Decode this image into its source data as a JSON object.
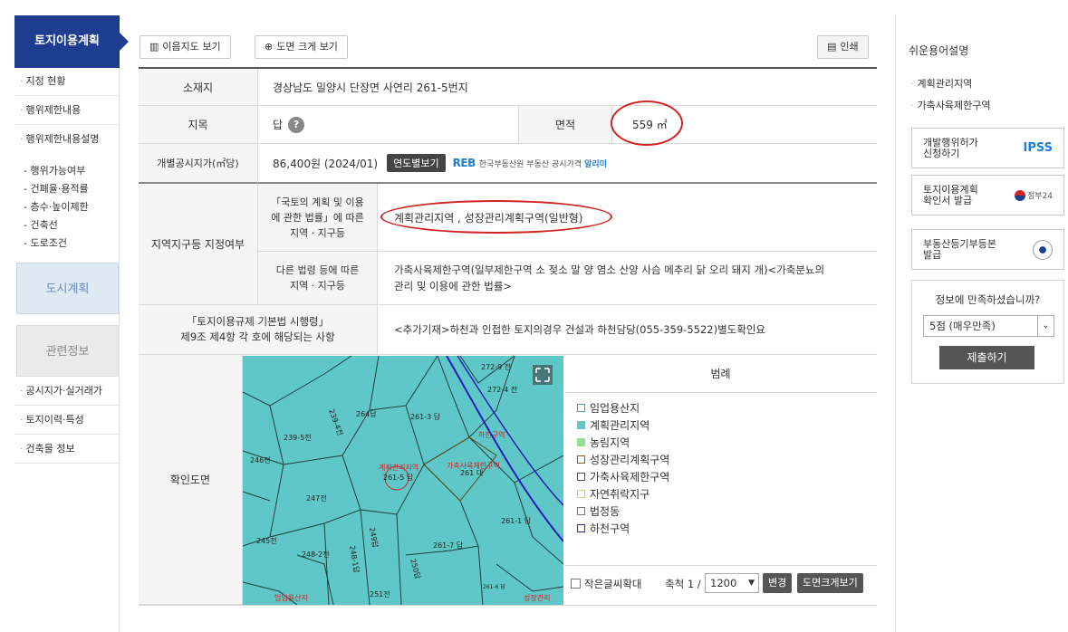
{
  "sidebar": {
    "title": "토지이용계획",
    "items": [
      "지정 현황",
      "행위제한내용",
      "행위제한내용설명"
    ],
    "subitems": [
      "- 행위가능여부",
      "- 건폐율·용적률",
      "- 층수·높이제한",
      "- 건축선",
      "- 도로조건"
    ],
    "city_plan": "도시계획",
    "related_info": "관련정보",
    "related_items": [
      "공시지가·실거래가",
      "토지이력·특성",
      "건축물 정보"
    ]
  },
  "toolbar": {
    "map_btn": "이음지도 보기",
    "zoom_btn": "도면 크게 보기",
    "print_btn": "인쇄"
  },
  "table": {
    "location_label": "소재지",
    "location_value": "경상남도 밀양시 단장면 사연리 261-5번지",
    "category_label": "지목",
    "category_value": "답",
    "area_label": "면적",
    "area_value": "559 ㎡",
    "price_label": "개별공시지가(㎡당)",
    "price_value": "86,400원 (2024/01)",
    "year_btn": "연도별보기",
    "reb_logo": "REB",
    "reb_text": "한국부동산원 부동산 공시가격",
    "reb_link": "알리미",
    "zone_label": "지역지구등 지정여부",
    "national_law_label_1": "「국토의 계획 및 이용",
    "national_law_label_2": "에 관한 법률」에 따른",
    "national_law_label_3": "지역 · 지구등",
    "national_law_value": "계획관리지역 , 성장관리계획구역(일반형)",
    "other_law_label_1": "다른 법령 등에 따른",
    "other_law_label_2": "지역 · 지구등",
    "other_law_value_1": "가축사육제한구역(일부제한구역 소 젖소 말 양 염소 산양 사슴 메추리 닭 오리 돼지 개)<가축분뇨의",
    "other_law_value_2": "관리 및 이용에 관한 법률>",
    "decree_label_1": "「토지이용규제 기본법 시행령」",
    "decree_label_2": "제9조 제4항 각 호에 해당되는 사항",
    "decree_value": "<추가기재>하천과 인접한 토지의경우 건설과 하천담당(055-359-5522)별도확인요",
    "map_label": "확인도면"
  },
  "map": {
    "labels": [
      "272-9 전",
      "272-4 전",
      "239-4전",
      "264답",
      "261-3 답",
      "239-5전",
      "246전",
      "계획관리지역",
      "261-5 답",
      "가축사육제한구역",
      "261 대",
      "247전",
      "261-1 답",
      "245전",
      "248-2전",
      "248-1답",
      "249답",
      "261-7 답",
      "250답",
      "251전",
      "임업용산지",
      "261-6 답",
      "하천구역",
      "성장관리"
    ]
  },
  "legend": {
    "title": "범례",
    "items": [
      {
        "label": "임업용산지",
        "color": "#ffffff",
        "border": "#4aa8a8"
      },
      {
        "label": "계획관리지역",
        "color": "#5fc7c7",
        "border": "#5fc7c7"
      },
      {
        "label": "농림지역",
        "color": "#8fe08f",
        "border": "#8fe08f"
      },
      {
        "label": "성장관리계획구역",
        "color": "#ffffff",
        "border": "#8a5a2b"
      },
      {
        "label": "가축사육제한구역",
        "color": "#ffffff",
        "border": "#555555"
      },
      {
        "label": "자연취락지구",
        "color": "#ffffff",
        "border": "#d4d46a"
      },
      {
        "label": "법정동",
        "color": "#ffffff",
        "border": "#777777"
      },
      {
        "label": "하천구역",
        "color": "#ffffff",
        "border": "#2b2bb5"
      }
    ],
    "small_text": "작은글씨확대",
    "scale_label": "축척 1 /",
    "scale_value": "1200",
    "change_btn": "변경",
    "zoom_btn": "도면크게보기"
  },
  "right": {
    "title": "쉬운용어설명",
    "links": [
      "계획관리지역",
      "가축사육제한구역"
    ],
    "btn1_1": "개발행위허가",
    "btn1_2": "신청하기",
    "btn1_logo": "IPSS",
    "btn2_1": "토지이용계획",
    "btn2_2": "확인서 발급",
    "btn2_logo": "정부24",
    "btn3_1": "부동산등기부등본",
    "btn3_2": "발급",
    "survey_question": "정보에 만족하셨습니까?",
    "survey_option": "5점 (매우만족)",
    "survey_submit": "제출하기"
  }
}
